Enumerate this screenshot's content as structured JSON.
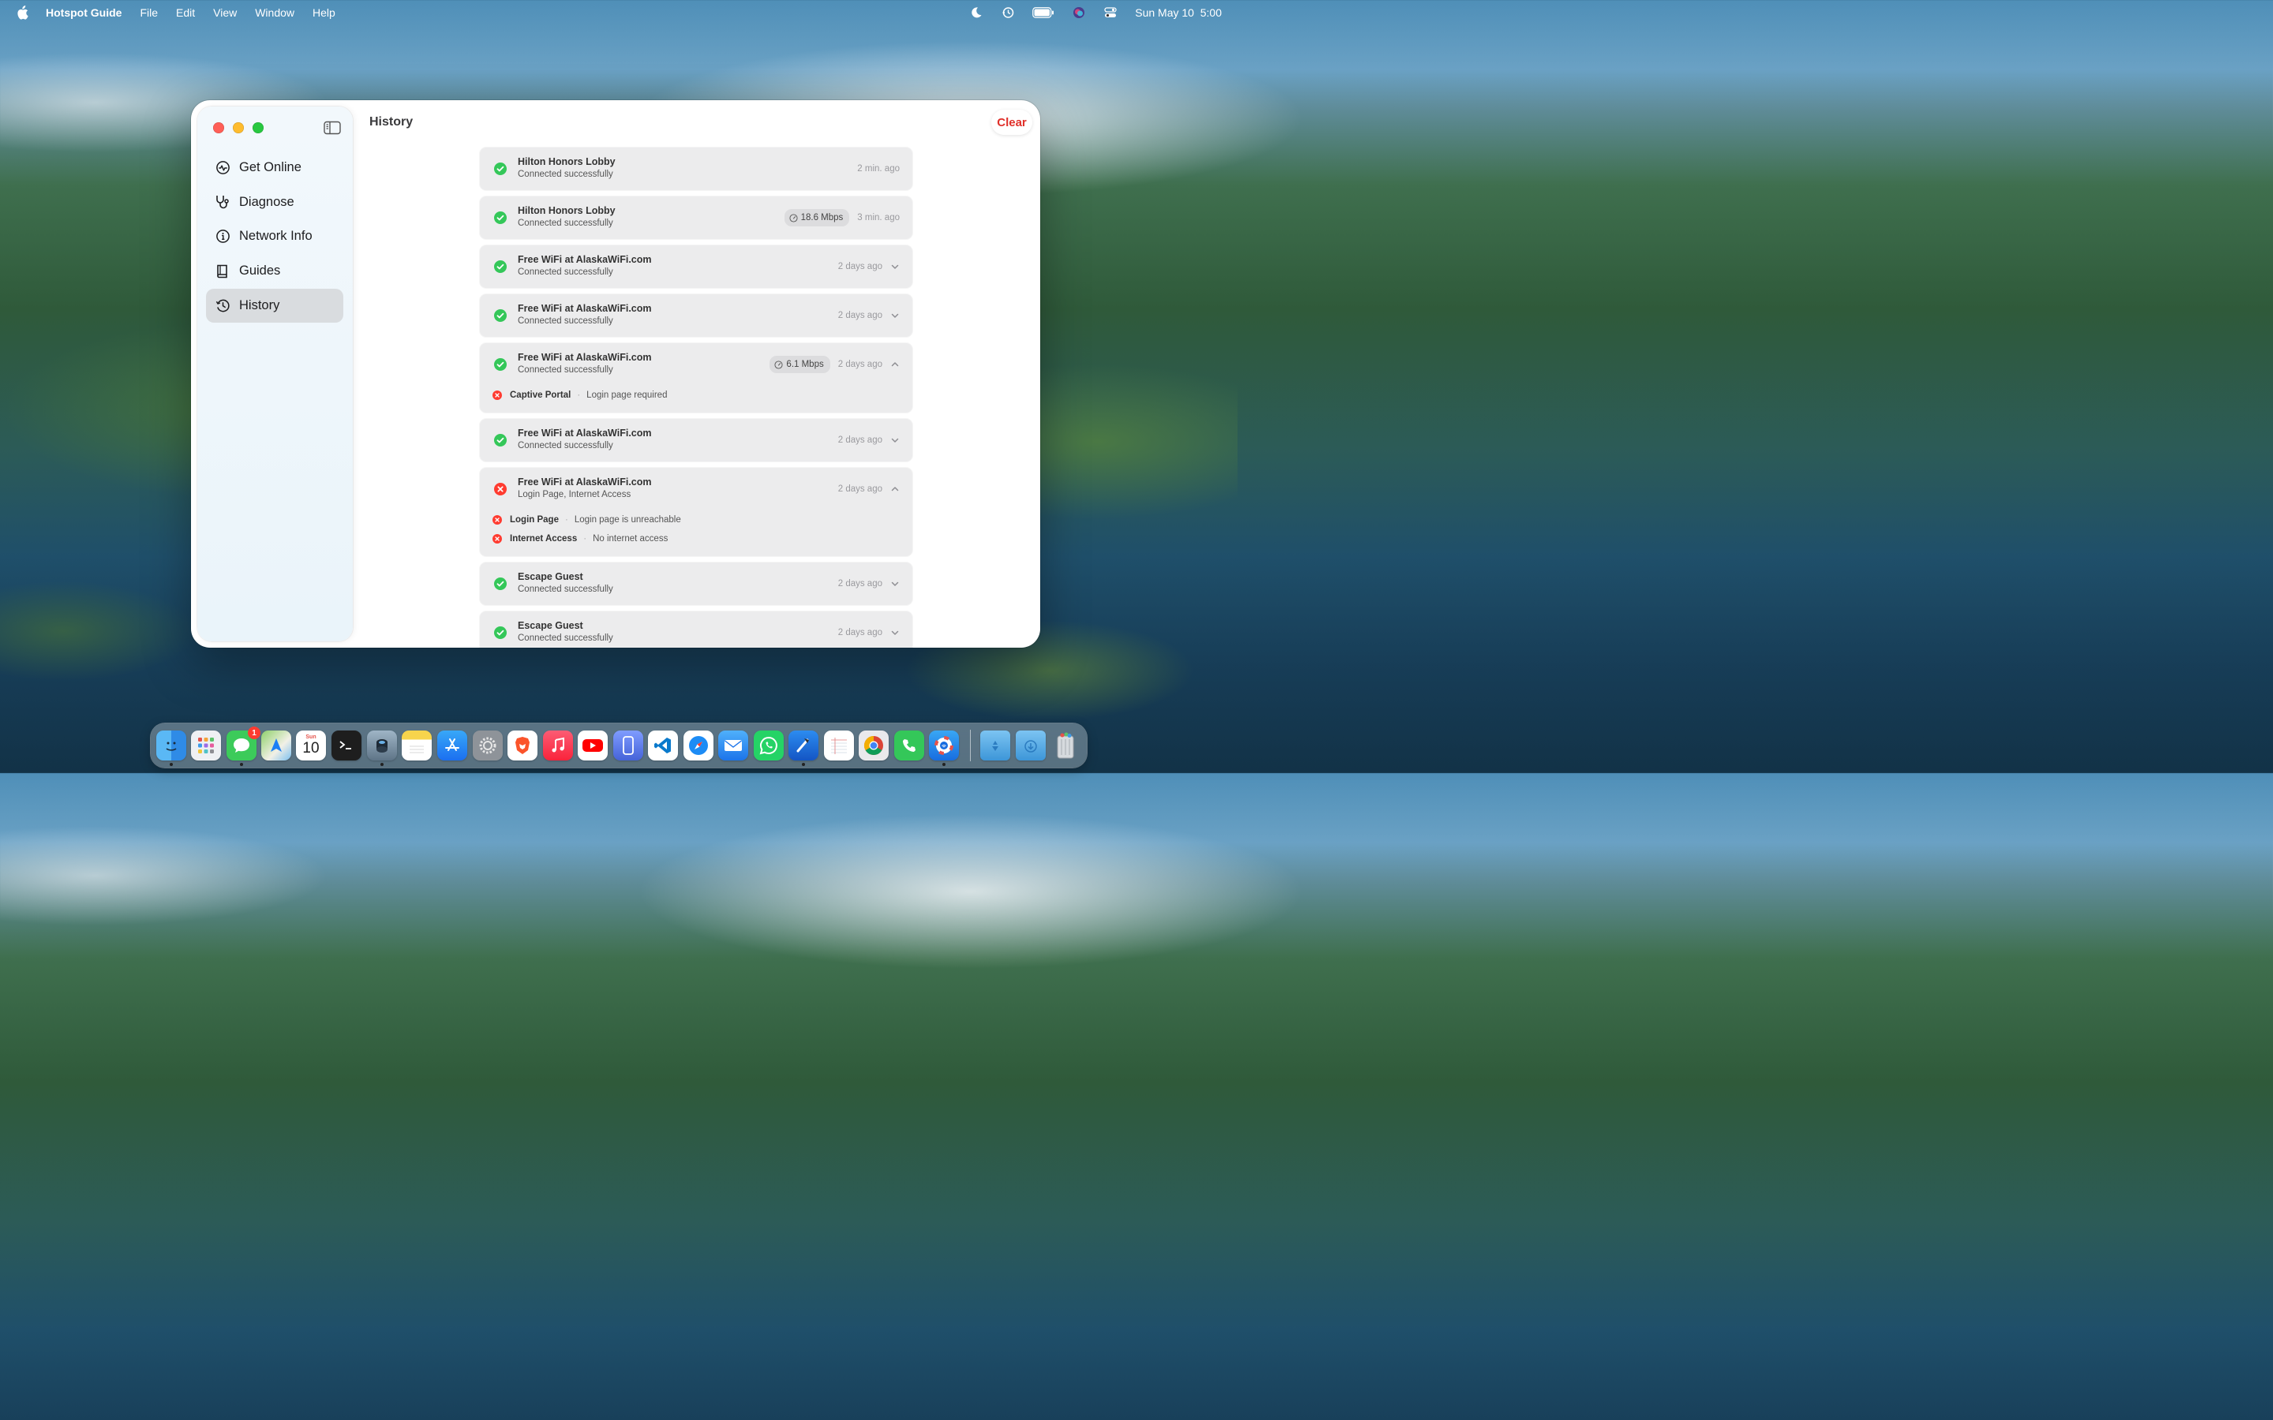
{
  "menubar": {
    "app_name": "Hotspot Guide",
    "items": [
      "File",
      "Edit",
      "View",
      "Window",
      "Help"
    ],
    "clock": "Sun May 10  5:00"
  },
  "window": {
    "title": "History",
    "clear_label": "Clear"
  },
  "sidebar": {
    "items": [
      {
        "label": "Get Online",
        "icon": "activity-icon"
      },
      {
        "label": "Diagnose",
        "icon": "stethoscope-icon"
      },
      {
        "label": "Network Info",
        "icon": "info-icon"
      },
      {
        "label": "Guides",
        "icon": "book-icon"
      },
      {
        "label": "History",
        "icon": "clock-history-icon",
        "active": true
      }
    ]
  },
  "history": [
    {
      "name": "Hilton Honors Lobby",
      "status_text": "Connected successfully",
      "time": "2 min. ago",
      "ok": true
    },
    {
      "name": "Hilton Honors Lobby",
      "status_text": "Connected successfully",
      "time": "3 min. ago",
      "speed": "18.6 Mbps",
      "ok": true
    },
    {
      "name": "Free WiFi at AlaskaWiFi.com",
      "status_text": "Connected successfully",
      "time": "2 days ago",
      "ok": true,
      "chevron": "down"
    },
    {
      "name": "Free WiFi at AlaskaWiFi.com",
      "status_text": "Connected successfully",
      "time": "2 days ago",
      "ok": true,
      "chevron": "down"
    },
    {
      "name": "Free WiFi at AlaskaWiFi.com",
      "status_text": "Connected successfully",
      "time": "2 days ago",
      "speed": "6.1 Mbps",
      "ok": true,
      "chevron": "up",
      "details": [
        {
          "name": "Captive Portal",
          "message": "Login page required"
        }
      ]
    },
    {
      "name": "Free WiFi at AlaskaWiFi.com",
      "status_text": "Connected successfully",
      "time": "2 days ago",
      "ok": true,
      "chevron": "down"
    },
    {
      "name": "Free WiFi at AlaskaWiFi.com",
      "status_text": "Login Page, Internet Access",
      "time": "2 days ago",
      "ok": false,
      "chevron": "up",
      "details": [
        {
          "name": "Login Page",
          "message": "Login page is unreachable"
        },
        {
          "name": "Internet Access",
          "message": "No internet access"
        }
      ]
    },
    {
      "name": "Escape Guest",
      "status_text": "Connected successfully",
      "time": "2 days ago",
      "ok": true,
      "chevron": "down"
    },
    {
      "name": "Escape Guest",
      "status_text": "Connected successfully",
      "time": "2 days ago",
      "ok": true,
      "chevron": "down"
    }
  ],
  "colors": {
    "success": "#34c759",
    "error": "#ff3b30",
    "clear": "#e0302a"
  },
  "dock": {
    "messages_badge": "1",
    "calendar_month": "Sun",
    "calendar_day": "10",
    "apps": [
      "Finder",
      "Launchpad",
      "Messages",
      "Maps",
      "Calendar",
      "Terminal",
      "Privacy Tool",
      "Notes",
      "App Store",
      "System Settings",
      "Brave",
      "Music",
      "YouTube",
      "iPhone Mirroring",
      "VS Code",
      "Safari",
      "Mail",
      "WhatsApp",
      "Xcode",
      "TextEdit",
      "Chrome",
      "Phone",
      "Hotspot Guide",
      "Applications",
      "Downloads",
      "Trash"
    ]
  }
}
